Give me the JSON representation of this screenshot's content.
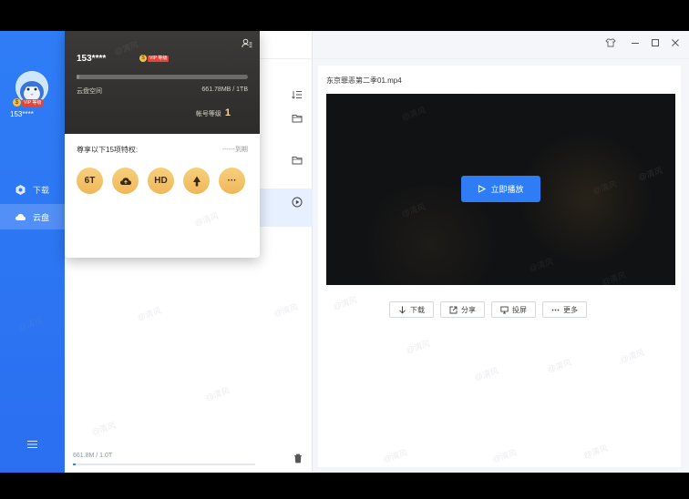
{
  "sidebar": {
    "username": "153****",
    "vip_tag": "VIP 等级",
    "nav": [
      {
        "label": "下载",
        "icon": "download-gear-icon"
      },
      {
        "label": "云盘",
        "icon": "cloud-icon"
      }
    ]
  },
  "popover": {
    "username": "153****",
    "vip_tag": "VIP 等级",
    "storage_label": "云盘空间",
    "storage_value": "661.78MB / 1TB",
    "storage_fraction": 0.0006,
    "level_label": "帐号等级",
    "level_value": "1",
    "perks_title": "尊享以下15项特权:",
    "expire_text": "------到期",
    "perks": [
      {
        "label": "6T",
        "icon": "6t-icon"
      },
      {
        "label": "",
        "icon": "cloud-upload-icon"
      },
      {
        "label": "HD",
        "icon": "hd-icon"
      },
      {
        "label": "",
        "icon": "speed-up-icon"
      },
      {
        "label": "···",
        "icon": "more-icon"
      }
    ]
  },
  "filelist": {
    "storage_footer": "661.8M / 1.0T",
    "storage_fraction": 0.01
  },
  "preview": {
    "filename": "东京罪恶第二季01.mp4",
    "play_label": "立即播放",
    "actions": [
      {
        "label": "下载",
        "icon": "download-icon"
      },
      {
        "label": "分享",
        "icon": "share-icon"
      },
      {
        "label": "投屏",
        "icon": "cast-icon"
      },
      {
        "label": "更多",
        "icon": "more-dots-icon"
      }
    ]
  },
  "watermark": "@清风",
  "colors": {
    "sidebar_blue": "#2f7df6",
    "accent_blue": "#2f7df6",
    "popover_dark": "#34322f",
    "perk_gold": "#f3c26a"
  }
}
